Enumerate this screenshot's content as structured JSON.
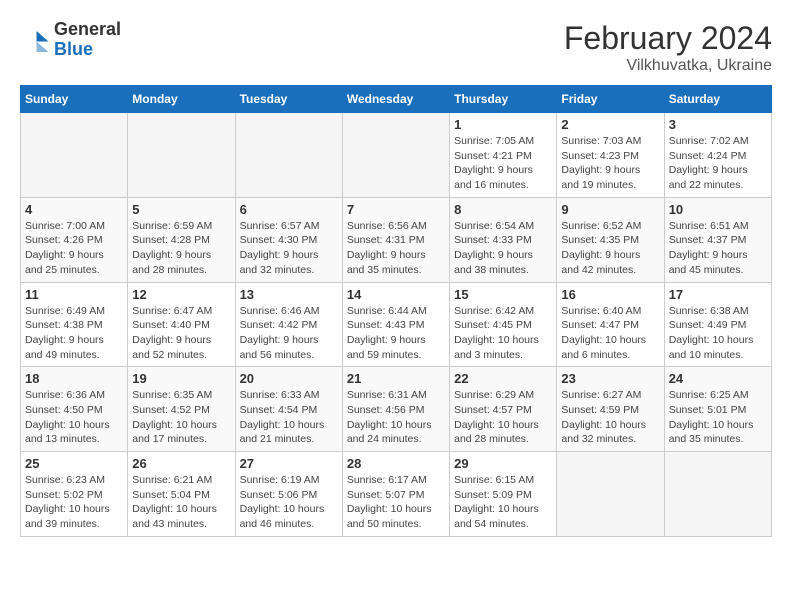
{
  "header": {
    "logo_line1": "General",
    "logo_line2": "Blue",
    "title": "February 2024",
    "subtitle": "Vilkhuvatka, Ukraine"
  },
  "days_of_week": [
    "Sunday",
    "Monday",
    "Tuesday",
    "Wednesday",
    "Thursday",
    "Friday",
    "Saturday"
  ],
  "weeks": [
    [
      {
        "day": "",
        "content": ""
      },
      {
        "day": "",
        "content": ""
      },
      {
        "day": "",
        "content": ""
      },
      {
        "day": "",
        "content": ""
      },
      {
        "day": "1",
        "content": "Sunrise: 7:05 AM\nSunset: 4:21 PM\nDaylight: 9 hours and 16 minutes."
      },
      {
        "day": "2",
        "content": "Sunrise: 7:03 AM\nSunset: 4:23 PM\nDaylight: 9 hours and 19 minutes."
      },
      {
        "day": "3",
        "content": "Sunrise: 7:02 AM\nSunset: 4:24 PM\nDaylight: 9 hours and 22 minutes."
      }
    ],
    [
      {
        "day": "4",
        "content": "Sunrise: 7:00 AM\nSunset: 4:26 PM\nDaylight: 9 hours and 25 minutes."
      },
      {
        "day": "5",
        "content": "Sunrise: 6:59 AM\nSunset: 4:28 PM\nDaylight: 9 hours and 28 minutes."
      },
      {
        "day": "6",
        "content": "Sunrise: 6:57 AM\nSunset: 4:30 PM\nDaylight: 9 hours and 32 minutes."
      },
      {
        "day": "7",
        "content": "Sunrise: 6:56 AM\nSunset: 4:31 PM\nDaylight: 9 hours and 35 minutes."
      },
      {
        "day": "8",
        "content": "Sunrise: 6:54 AM\nSunset: 4:33 PM\nDaylight: 9 hours and 38 minutes."
      },
      {
        "day": "9",
        "content": "Sunrise: 6:52 AM\nSunset: 4:35 PM\nDaylight: 9 hours and 42 minutes."
      },
      {
        "day": "10",
        "content": "Sunrise: 6:51 AM\nSunset: 4:37 PM\nDaylight: 9 hours and 45 minutes."
      }
    ],
    [
      {
        "day": "11",
        "content": "Sunrise: 6:49 AM\nSunset: 4:38 PM\nDaylight: 9 hours and 49 minutes."
      },
      {
        "day": "12",
        "content": "Sunrise: 6:47 AM\nSunset: 4:40 PM\nDaylight: 9 hours and 52 minutes."
      },
      {
        "day": "13",
        "content": "Sunrise: 6:46 AM\nSunset: 4:42 PM\nDaylight: 9 hours and 56 minutes."
      },
      {
        "day": "14",
        "content": "Sunrise: 6:44 AM\nSunset: 4:43 PM\nDaylight: 9 hours and 59 minutes."
      },
      {
        "day": "15",
        "content": "Sunrise: 6:42 AM\nSunset: 4:45 PM\nDaylight: 10 hours and 3 minutes."
      },
      {
        "day": "16",
        "content": "Sunrise: 6:40 AM\nSunset: 4:47 PM\nDaylight: 10 hours and 6 minutes."
      },
      {
        "day": "17",
        "content": "Sunrise: 6:38 AM\nSunset: 4:49 PM\nDaylight: 10 hours and 10 minutes."
      }
    ],
    [
      {
        "day": "18",
        "content": "Sunrise: 6:36 AM\nSunset: 4:50 PM\nDaylight: 10 hours and 13 minutes."
      },
      {
        "day": "19",
        "content": "Sunrise: 6:35 AM\nSunset: 4:52 PM\nDaylight: 10 hours and 17 minutes."
      },
      {
        "day": "20",
        "content": "Sunrise: 6:33 AM\nSunset: 4:54 PM\nDaylight: 10 hours and 21 minutes."
      },
      {
        "day": "21",
        "content": "Sunrise: 6:31 AM\nSunset: 4:56 PM\nDaylight: 10 hours and 24 minutes."
      },
      {
        "day": "22",
        "content": "Sunrise: 6:29 AM\nSunset: 4:57 PM\nDaylight: 10 hours and 28 minutes."
      },
      {
        "day": "23",
        "content": "Sunrise: 6:27 AM\nSunset: 4:59 PM\nDaylight: 10 hours and 32 minutes."
      },
      {
        "day": "24",
        "content": "Sunrise: 6:25 AM\nSunset: 5:01 PM\nDaylight: 10 hours and 35 minutes."
      }
    ],
    [
      {
        "day": "25",
        "content": "Sunrise: 6:23 AM\nSunset: 5:02 PM\nDaylight: 10 hours and 39 minutes."
      },
      {
        "day": "26",
        "content": "Sunrise: 6:21 AM\nSunset: 5:04 PM\nDaylight: 10 hours and 43 minutes."
      },
      {
        "day": "27",
        "content": "Sunrise: 6:19 AM\nSunset: 5:06 PM\nDaylight: 10 hours and 46 minutes."
      },
      {
        "day": "28",
        "content": "Sunrise: 6:17 AM\nSunset: 5:07 PM\nDaylight: 10 hours and 50 minutes."
      },
      {
        "day": "29",
        "content": "Sunrise: 6:15 AM\nSunset: 5:09 PM\nDaylight: 10 hours and 54 minutes."
      },
      {
        "day": "",
        "content": ""
      },
      {
        "day": "",
        "content": ""
      }
    ]
  ]
}
